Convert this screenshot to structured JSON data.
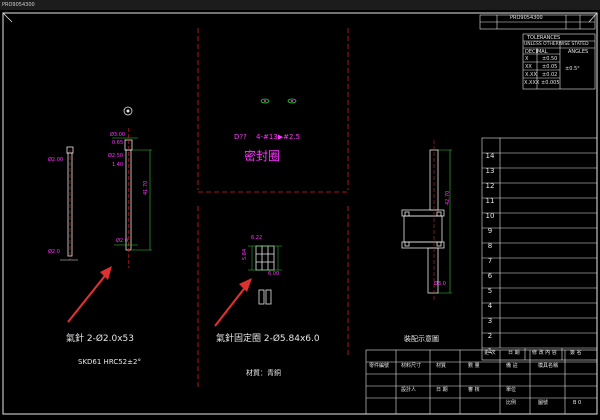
{
  "window": {
    "title_strip": "PRO9054300"
  },
  "top_block": {
    "title": "PRO9054300",
    "sub": ""
  },
  "tolerances": {
    "header": "TOLERANCES",
    "sub_header": "UNLESS OTHERWISE STATED",
    "col_decimal": "DECIMAL",
    "col_angle": "ANGLES",
    "rows": [
      {
        "label": "X",
        "value": "±0.50"
      },
      {
        "label": "XX",
        "value": "±0.05"
      },
      {
        "label": "X.XX",
        "value": "±0.02"
      },
      {
        "label": "X.XXX",
        "value": "±0.005"
      }
    ],
    "angle_value": "±0.5°"
  },
  "notes": {
    "seal": "密封圈",
    "hole_spec": "4-#13▶#2.5",
    "hole_prefix": "D??"
  },
  "part_labels": {
    "needle": "氣針 2-Ø2.0x53",
    "needle_material": "SKD61   HRC52±2°",
    "fixing": "氣針固定圈 2-Ø5.84x6.0",
    "fixing_material": "材質：青銅",
    "assembly": "裝配示意圖"
  },
  "dims": {
    "d200": "Ø2.00",
    "d300": "Ø3.00",
    "d065": "0.65",
    "d140": "1.40",
    "d250": "Ø2.50",
    "d4170": "41.70",
    "d20": "Ø2.0",
    "d584": "5.84",
    "d622": "6.22",
    "d600": "6.00",
    "d4270": "42.70",
    "d30": "Ø3.0"
  },
  "revision_table": {
    "rows": [
      "14",
      "13",
      "12",
      "11",
      "10",
      "9",
      "8",
      "7",
      "6",
      "5",
      "4",
      "3",
      "2",
      "1"
    ],
    "footer": [
      "更 次",
      "日 期",
      "修 改 內 容",
      "簽 名"
    ]
  },
  "title_block": {
    "cells": [
      {
        "label": "零件編號",
        "value": "零件編號"
      },
      {
        "label": "材料尺寸",
        "value": "材料尺寸"
      },
      {
        "label": "材質",
        "value": "材質"
      },
      {
        "label": "數量",
        "value": "數 量"
      },
      {
        "label": "備 註",
        "value": "備 註"
      },
      {
        "label": "模具名稱",
        "value": "模具名稱"
      },
      {
        "label": "名 日",
        "value": "設計人"
      },
      {
        "label": "日期",
        "value": "日 期"
      },
      {
        "label": "審 核",
        "value": "審 核"
      },
      {
        "label": "單位",
        "value": "單位"
      },
      {
        "label": "比例",
        "value": "比例"
      },
      {
        "label": "圖號",
        "value": "圖號"
      }
    ],
    "mold_name": "模具名稱",
    "page": "B 0"
  }
}
